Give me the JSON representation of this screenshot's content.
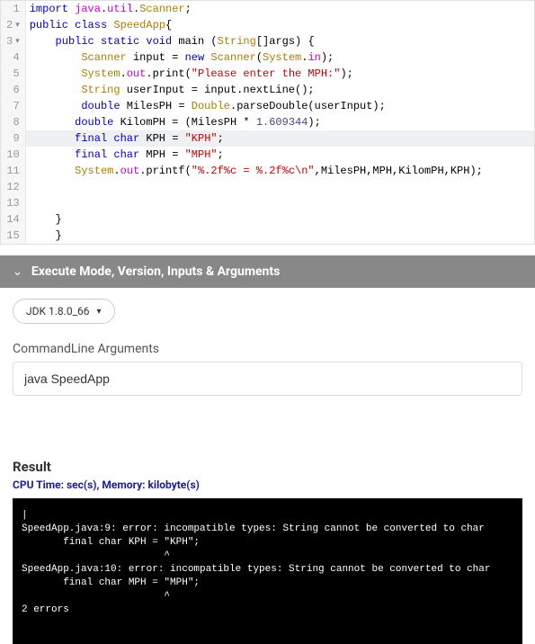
{
  "editor": {
    "line_numbers": [
      "1",
      "2",
      "3",
      "4",
      "5",
      "6",
      "7",
      "8",
      "9",
      "10",
      "11",
      "12",
      "13",
      "14",
      "15"
    ],
    "fold_lines": [
      2,
      3
    ],
    "highlighted_line": 9,
    "code_html": [
      "<span class='kw'>import</span> <span class='pkg'>java</span>.<span class='pkg'>util</span>.<span class='cls'>Scanner</span>;",
      "<span class='kw'>public</span> <span class='kw'>class</span> <span class='cls'>SpeedApp</span>{",
      "    <span class='kw'>public</span> <span class='kw'>static</span> <span class='kw'>void</span> main (<span class='cls'>String</span>[]args) {",
      "        <span class='cls'>Scanner</span> input = <span class='kw'>new</span> <span class='cls'>Scanner</span>(<span class='cls'>System</span>.<span class='pkg'>in</span>);",
      "        <span class='cls'>System</span>.<span class='pkg'>out</span>.print(<span class='str'>\"Please enter the MPH:\"</span>);",
      "        <span class='cls'>String</span> userInput = input.nextLine();",
      "        <span class='kw'>double</span> MilesPH = <span class='cls'>Double</span>.parseDouble(userInput);",
      "       <span class='kw'>double</span> KilomPH = (MilesPH * <span class='num'>1.609344</span>);",
      "       <span class='kw'>final</span> <span class='kw'>char</span> KPH = <span class='str'>\"KPH\"</span>;",
      "       <span class='kw'>final</span> <span class='kw'>char</span> MPH = <span class='str'>\"MPH\"</span>;",
      "       <span class='cls'>System</span>.<span class='pkg'>out</span>.printf(<span class='str'>\"%.2f%c = %.2f%c\\n\"</span>,MilesPH,MPH,KilomPH,KPH);",
      "",
      "",
      "    }",
      "    }"
    ]
  },
  "section_header": "Execute Mode, Version, Inputs & Arguments",
  "jdk_version": "JDK 1.8.0_66",
  "cmd_label": "CommandLine Arguments",
  "cmd_value": "java SpeedApp",
  "result_title": "Result",
  "cpu_mem": "CPU Time: sec(s), Memory: kilobyte(s)",
  "terminal_output": "|\nSpeedApp.java:9: error: incompatible types: String cannot be converted to char\n       final char KPH = \"KPH\";\n                        ^\nSpeedApp.java:10: error: incompatible types: String cannot be converted to char\n       final char MPH = \"MPH\";\n                        ^\n2 errors\n"
}
